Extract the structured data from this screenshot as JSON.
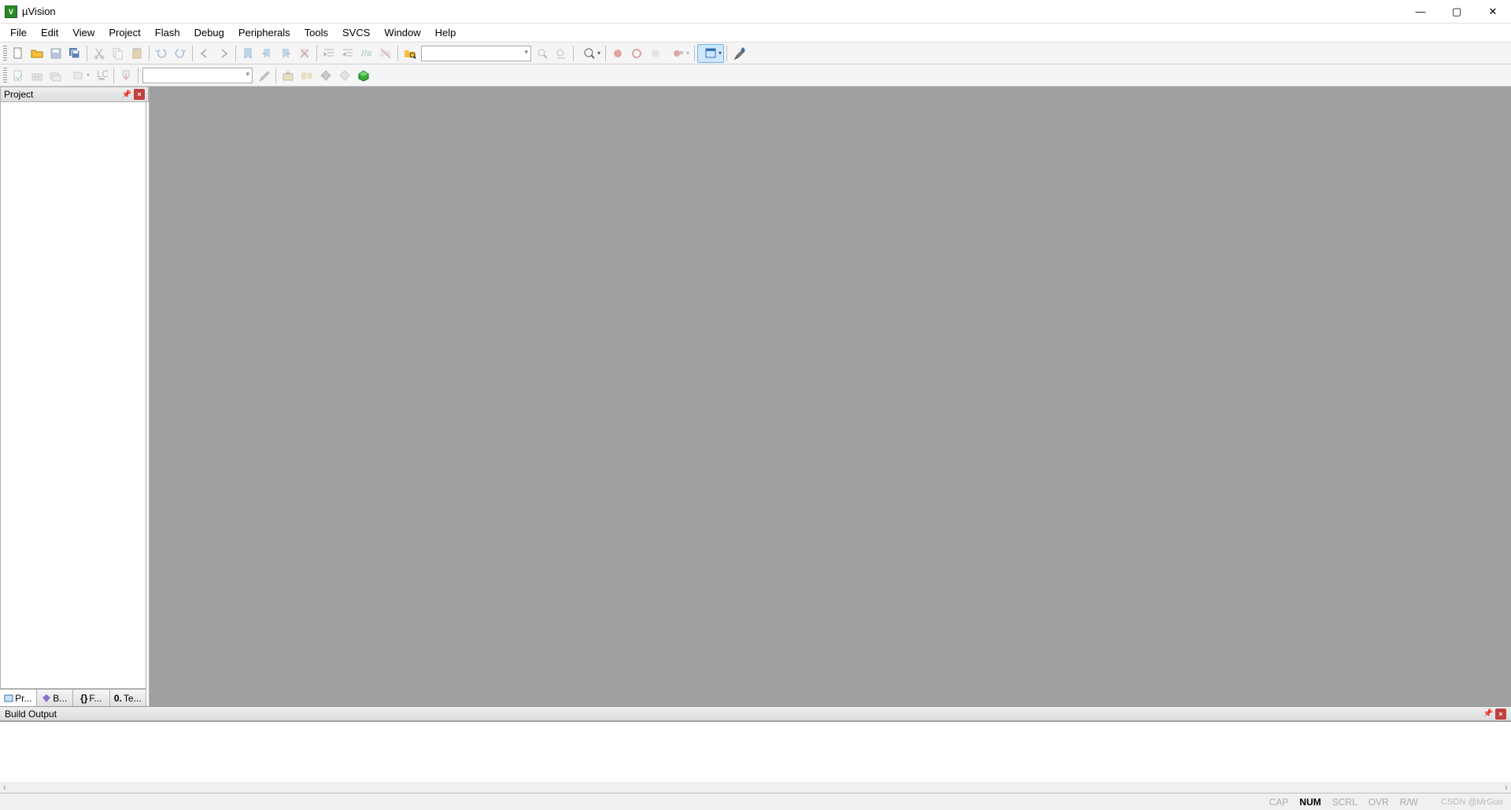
{
  "title": "µVision",
  "menu": [
    "File",
    "Edit",
    "View",
    "Project",
    "Flash",
    "Debug",
    "Peripherals",
    "Tools",
    "SVCS",
    "Window",
    "Help"
  ],
  "panels": {
    "project": "Project",
    "build": "Build Output"
  },
  "projtabs": [
    "Pr...",
    "B...",
    "F...",
    "Te..."
  ],
  "status": {
    "cap": "CAP",
    "num": "NUM",
    "scrl": "SCRL",
    "ovr": "OVR",
    "rw": "R/W"
  },
  "watermark": "CSDN @MrGuo"
}
